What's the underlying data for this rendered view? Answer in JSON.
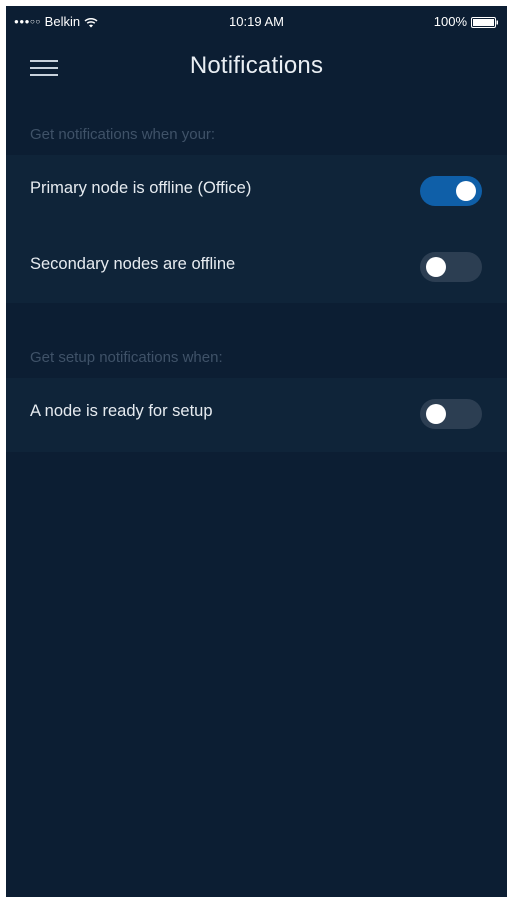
{
  "status_bar": {
    "signal": "●●●○○",
    "carrier": "Belkin",
    "time": "10:19 AM",
    "battery_percent": "100%",
    "battery_level": 1.0
  },
  "header": {
    "title": "Notifications",
    "menu_icon": "hamburger-menu-icon"
  },
  "sections": [
    {
      "header": "Get notifications when your:",
      "items": [
        {
          "label": "Primary node is offline (Office)",
          "enabled": true
        },
        {
          "label": "Secondary nodes are offline",
          "enabled": false
        }
      ]
    },
    {
      "header": "Get setup notifications when:",
      "items": [
        {
          "label": "A node is ready for setup",
          "enabled": false
        }
      ]
    }
  ],
  "colors": {
    "background": "#0c1e33",
    "row_background": "#0f2439",
    "section_header": "#3f5268",
    "toggle_on": "#0f5fa8",
    "toggle_off": "#2c3e52"
  }
}
